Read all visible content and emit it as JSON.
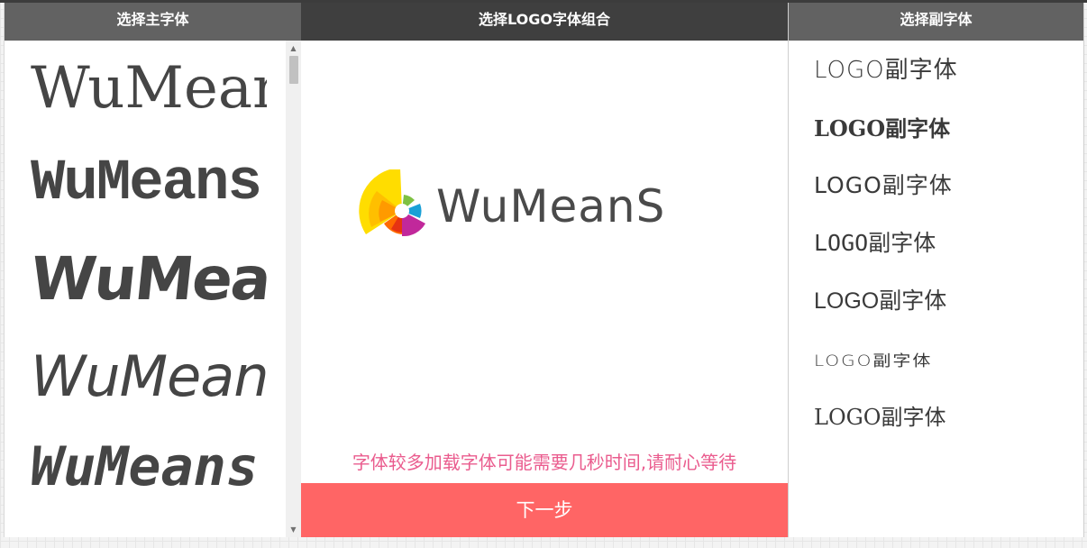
{
  "left_panel": {
    "title": "选择主字体",
    "font_samples": [
      "WuMeans",
      "WuMeans",
      "WuMeans",
      "WuMeans",
      "WuMeans"
    ]
  },
  "center_panel": {
    "title": "选择LOGO字体组合",
    "logo_text": "WuMeanS",
    "notice": "字体较多加载字体可能需要几秒时间,请耐心等待",
    "next_button": "下一步"
  },
  "right_panel": {
    "title": "选择副字体",
    "font_samples": [
      "LOGO副字体",
      "LOGO副字体",
      "LOGO副字体",
      "LOGO副字体",
      "LOGO副字体",
      "LOGO副字体",
      "LOGO副字体"
    ]
  },
  "colors": {
    "header_dark": "#3f3f3f",
    "header_gray": "#626262",
    "accent_button": "#ff6565",
    "notice_text": "#ea5c8e"
  }
}
